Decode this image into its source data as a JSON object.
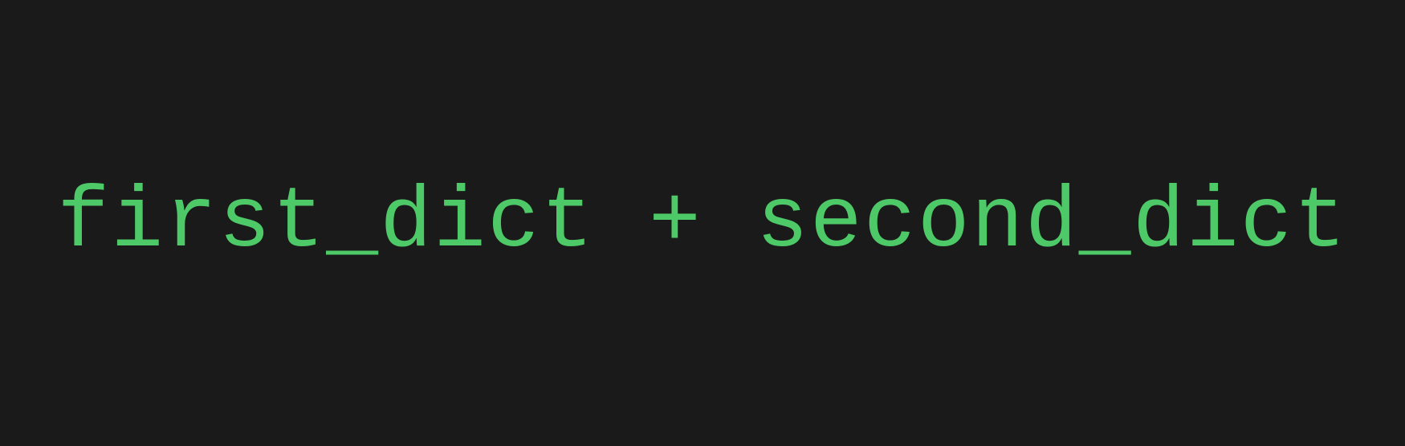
{
  "code": {
    "expression": "first_dict + second_dict"
  }
}
